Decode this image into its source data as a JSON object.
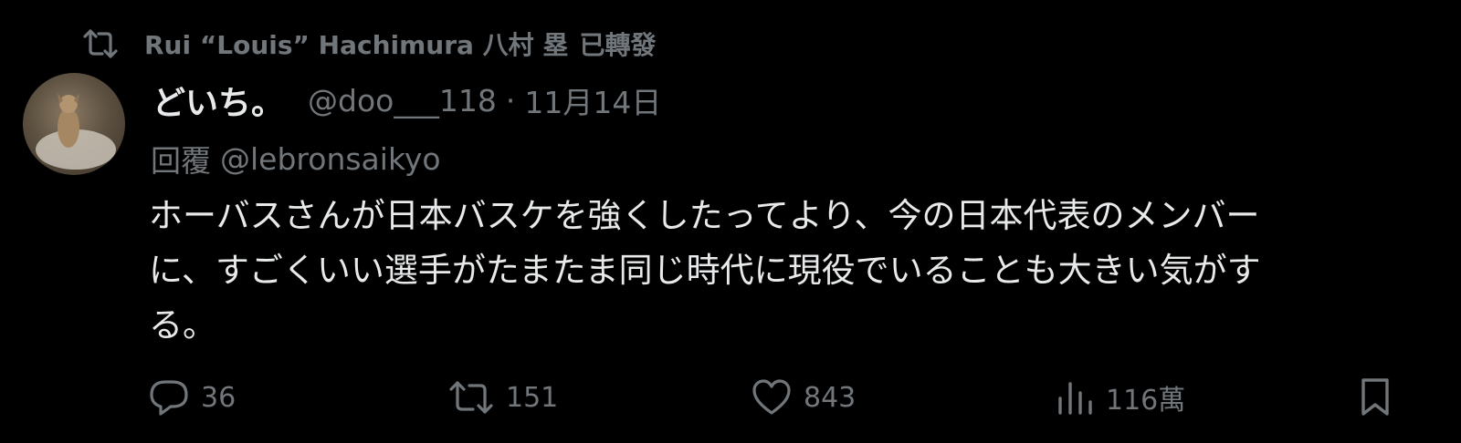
{
  "repost_header": {
    "icon": "repost-icon",
    "reposter_name": "Rui “Louis” Hachimura 八村 塁",
    "reposted_label": "已轉發"
  },
  "tweet": {
    "author_avatar": "avatar",
    "display_name": "どいち。",
    "handle": "@doo___118",
    "separator": "·",
    "date": "11月14日",
    "reply_label": "回覆",
    "reply_to": "@lebronsaikyo",
    "text_lines": [
      "ホーバスさんが日本バスケを強くしたってより、今の日本代表のメンバー",
      "に、すごくいい選手がたまたま同じ時代に現役でいることも大きい気がす",
      "る。"
    ]
  },
  "actions": {
    "reply": {
      "icon": "reply-icon",
      "count": "36"
    },
    "repost": {
      "icon": "repost-icon",
      "count": "151"
    },
    "like": {
      "icon": "heart-icon",
      "count": "843"
    },
    "views": {
      "icon": "views-icon",
      "count": "116萬"
    },
    "bookmark": {
      "icon": "bookmark-icon"
    }
  },
  "colors": {
    "background": "#000000",
    "primary_text": "#e7e9ea",
    "secondary_text": "#71767b"
  }
}
